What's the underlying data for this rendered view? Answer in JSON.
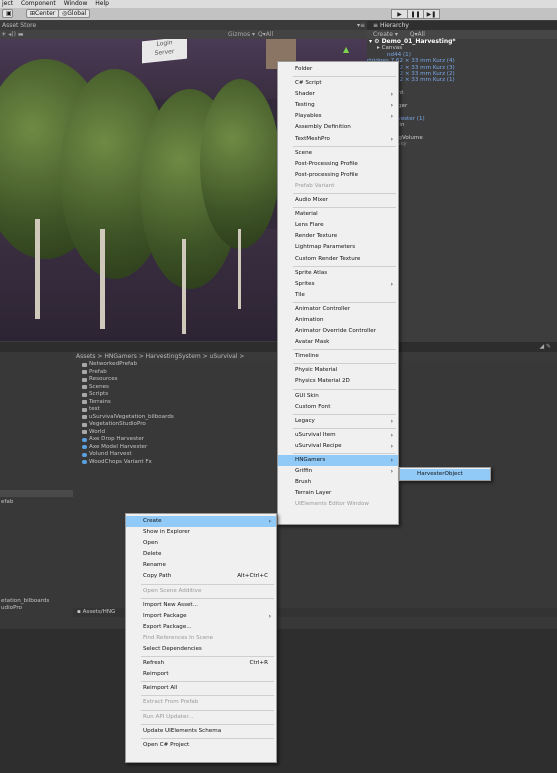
{
  "menubar": {
    "items": [
      "ject",
      "Component",
      "Window",
      "Help"
    ]
  },
  "toolbar": {
    "pivot": "Center",
    "space": "Global"
  },
  "scene": {
    "tab": "Asset Store",
    "gizmos": "Gizmos ▾",
    "search": "Q▾All",
    "signs": [
      "Login",
      "Server"
    ]
  },
  "hierarchy": {
    "tab": "Hierarchy",
    "create": "Create ▾",
    "search": "Q▾All",
    "rows": [
      {
        "text": "▾ ⚙ Demo_01_Harvesting*",
        "style": "root",
        "indent": 2
      },
      {
        "text": "▸ Canvas",
        "style": "",
        "indent": 10
      },
      {
        "text": "nd44 (1)",
        "style": "blue",
        "indent": 20
      },
      {
        "text": "rtridges 7,62 × 33 mm Kurz (4)",
        "style": "blue",
        "indent": 0
      },
      {
        "text": "rtridges 7,62 × 33 mm Kurz (3)",
        "style": "blue",
        "indent": 0
      },
      {
        "text": "rtridges 7,62 × 33 mm Kurz (2)",
        "style": "blue",
        "indent": 0
      },
      {
        "text": "rtridges 7,62 × 33 mm Kurz (1)",
        "style": "blue",
        "indent": 0
      },
      {
        "text": "ntSystem",
        "style": "",
        "indent": 0
      },
      {
        "text": "ectional light",
        "style": "",
        "indent": 0
      },
      {
        "text": "in Camera",
        "style": "",
        "indent": 0
      },
      {
        "text": "tworkManager",
        "style": "",
        "indent": 0
      },
      {
        "text": "Spawn",
        "style": "",
        "indent": 0
      },
      {
        "text": "e Drop Harvester (1)",
        "style": "blue",
        "indent": 0
      },
      {
        "text": "tilized Terrain",
        "style": "",
        "indent": 0
      },
      {
        "text": "ffin Tools",
        "style": "",
        "indent": 0
      },
      {
        "text": "stProcessingVolume",
        "style": "",
        "indent": 0
      },
      {
        "text": "arry Night Sky",
        "style": "dim",
        "indent": 0
      },
      {
        "text": "nd Zone",
        "style": "",
        "indent": 0
      },
      {
        "text": "meObject",
        "style": "",
        "indent": 0
      }
    ]
  },
  "project": {
    "breadcrumb": "Assets > HNGamers > HarvestingSystem > uSurvival >",
    "items": [
      {
        "name": "NetworkedPrefab",
        "type": "folder"
      },
      {
        "name": "Prefab",
        "type": "folder"
      },
      {
        "name": "Resources",
        "type": "folder"
      },
      {
        "name": "Scenes",
        "type": "folder"
      },
      {
        "name": "Scripts",
        "type": "folder"
      },
      {
        "name": "Terrains",
        "type": "folder"
      },
      {
        "name": "test",
        "type": "folder"
      },
      {
        "name": "uSurvivalVegetation_bilboards",
        "type": "folder"
      },
      {
        "name": "VegetationStudioPro",
        "type": "folder"
      },
      {
        "name": "World",
        "type": "folder"
      },
      {
        "name": "Axe Drop Harvester",
        "type": "prefab"
      },
      {
        "name": "Axe Model Harvester",
        "type": "prefab"
      },
      {
        "name": "Volund Harvest",
        "type": "prefab"
      },
      {
        "name": "WoodChops Variant Fx",
        "type": "prefab"
      }
    ],
    "left_rows": [
      "efab",
      "etation_bilboards",
      "udioPro"
    ],
    "footer_path": "Assets/HNG"
  },
  "create_submenu": {
    "items": [
      {
        "label": "Folder",
        "arrow": false,
        "disabled": false,
        "sep_after": true
      },
      {
        "label": "C# Script",
        "arrow": false,
        "disabled": false
      },
      {
        "label": "Shader",
        "arrow": true,
        "disabled": false
      },
      {
        "label": "Testing",
        "arrow": true,
        "disabled": false
      },
      {
        "label": "Playables",
        "arrow": true,
        "disabled": false
      },
      {
        "label": "Assembly Definition",
        "arrow": false,
        "disabled": false
      },
      {
        "label": "TextMeshPro",
        "arrow": true,
        "disabled": false,
        "sep_after": true
      },
      {
        "label": "Scene",
        "arrow": false,
        "disabled": false
      },
      {
        "label": "Post-Processing Profile",
        "arrow": false,
        "disabled": false
      },
      {
        "label": "Post-processing Profile",
        "arrow": false,
        "disabled": false
      },
      {
        "label": "Prefab Variant",
        "arrow": false,
        "disabled": true,
        "sep_after": true
      },
      {
        "label": "Audio Mixer",
        "arrow": false,
        "disabled": false,
        "sep_after": true
      },
      {
        "label": "Material",
        "arrow": false,
        "disabled": false
      },
      {
        "label": "Lens Flare",
        "arrow": false,
        "disabled": false
      },
      {
        "label": "Render Texture",
        "arrow": false,
        "disabled": false
      },
      {
        "label": "Lightmap Parameters",
        "arrow": false,
        "disabled": false
      },
      {
        "label": "Custom Render Texture",
        "arrow": false,
        "disabled": false,
        "sep_after": true
      },
      {
        "label": "Sprite Atlas",
        "arrow": false,
        "disabled": false
      },
      {
        "label": "Sprites",
        "arrow": true,
        "disabled": false
      },
      {
        "label": "Tile",
        "arrow": false,
        "disabled": false,
        "sep_after": true
      },
      {
        "label": "Animator Controller",
        "arrow": false,
        "disabled": false
      },
      {
        "label": "Animation",
        "arrow": false,
        "disabled": false
      },
      {
        "label": "Animator Override Controller",
        "arrow": false,
        "disabled": false
      },
      {
        "label": "Avatar Mask",
        "arrow": false,
        "disabled": false,
        "sep_after": true
      },
      {
        "label": "Timeline",
        "arrow": false,
        "disabled": false,
        "sep_after": true
      },
      {
        "label": "Physic Material",
        "arrow": false,
        "disabled": false
      },
      {
        "label": "Physics Material 2D",
        "arrow": false,
        "disabled": false,
        "sep_after": true
      },
      {
        "label": "GUI Skin",
        "arrow": false,
        "disabled": false
      },
      {
        "label": "Custom Font",
        "arrow": false,
        "disabled": false,
        "sep_after": true
      },
      {
        "label": "Legacy",
        "arrow": true,
        "disabled": false,
        "sep_after": true
      },
      {
        "label": "uSurvival Item",
        "arrow": true,
        "disabled": false
      },
      {
        "label": "uSurvival Recipe",
        "arrow": true,
        "disabled": false,
        "sep_after": true
      },
      {
        "label": "HNGamers",
        "arrow": true,
        "disabled": false,
        "highlight": true
      },
      {
        "label": "Griffin",
        "arrow": true,
        "disabled": false
      },
      {
        "label": "Brush",
        "arrow": false,
        "disabled": false
      },
      {
        "label": "Terrain Layer",
        "arrow": false,
        "disabled": false
      },
      {
        "label": "UIElements Editor Window",
        "arrow": false,
        "disabled": true
      }
    ]
  },
  "hngamers_submenu": {
    "items": [
      {
        "label": "HarvesterObject",
        "highlight": true
      }
    ]
  },
  "context_menu": {
    "items": [
      {
        "label": "Create",
        "arrow": true,
        "highlight": true
      },
      {
        "label": "Show in Explorer"
      },
      {
        "label": "Open"
      },
      {
        "label": "Delete"
      },
      {
        "label": "Rename"
      },
      {
        "label": "Copy Path",
        "shortcut": "Alt+Ctrl+C",
        "sep_after": true
      },
      {
        "label": "Open Scene Additive",
        "disabled": true,
        "sep_after": true
      },
      {
        "label": "Import New Asset..."
      },
      {
        "label": "Import Package",
        "arrow": true
      },
      {
        "label": "Export Package..."
      },
      {
        "label": "Find References In Scene",
        "disabled": true
      },
      {
        "label": "Select Dependencies",
        "sep_after": true
      },
      {
        "label": "Refresh",
        "shortcut": "Ctrl+R"
      },
      {
        "label": "Reimport",
        "sep_after": true
      },
      {
        "label": "Reimport All",
        "sep_after": true
      },
      {
        "label": "Extract From Prefab",
        "disabled": true,
        "sep_after": true
      },
      {
        "label": "Run API Updater...",
        "disabled": true,
        "sep_after": true
      },
      {
        "label": "Update UIElements Schema",
        "sep_after": true
      },
      {
        "label": "Open C# Project"
      }
    ]
  }
}
